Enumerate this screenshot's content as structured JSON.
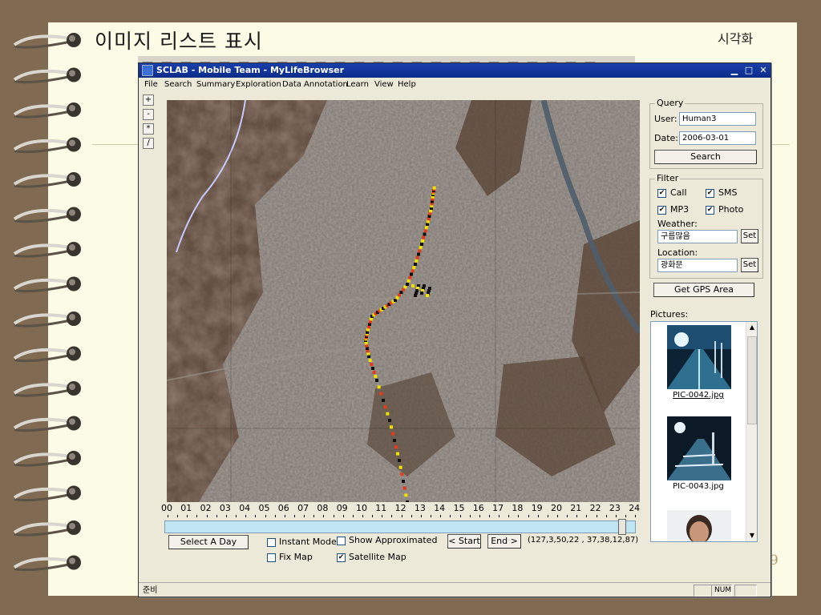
{
  "slide": {
    "title": "이미지 리스트 표시",
    "tag": "시각화",
    "page_number": "9"
  },
  "window": {
    "title": "SCLAB - Mobile Team - MyLifeBrowser",
    "minimize": "▁",
    "maximize": "□",
    "close": "✕"
  },
  "menu": [
    "File",
    "Search",
    "Summary",
    "Exploration",
    "Data Annotation",
    "Learn",
    "View",
    "Help"
  ],
  "tools": [
    "+",
    "-",
    "*",
    "/"
  ],
  "query": {
    "legend": "Query",
    "user_label": "User:",
    "user_value": "Human3",
    "date_label": "Date:",
    "date_value": "2006-03-01",
    "search_button": "Search"
  },
  "filter": {
    "legend": "Filter",
    "call": "Call",
    "sms": "SMS",
    "mp3": "MP3",
    "photo": "Photo",
    "call_checked": true,
    "sms_checked": true,
    "mp3_checked": true,
    "photo_checked": true,
    "weather_label": "Weather:",
    "weather_value": "구름많음",
    "location_label": "Location:",
    "location_value": "광화문",
    "set_button": "Set"
  },
  "gps_button": "Get GPS Area",
  "pictures": {
    "label": "Pictures:",
    "items": [
      "PIC-0042.jpg",
      "PIC-0043.jpg"
    ]
  },
  "timeline": {
    "hours": [
      "00",
      "01",
      "02",
      "03",
      "04",
      "05",
      "06",
      "07",
      "08",
      "09",
      "10",
      "11",
      "12",
      "13",
      "14",
      "15",
      "16",
      "17",
      "18",
      "19",
      "20",
      "21",
      "22",
      "23",
      "24"
    ],
    "slider_position": 0.98
  },
  "controls": {
    "select_day": "Select A Day",
    "instant_mode": "Instant Mode",
    "show_approx": "Show Approximated",
    "start": "< Start",
    "end": "End >",
    "coords": "(127,3,50,22 , 37,38,12,87)",
    "fix_map": "Fix Map",
    "satellite_map": "Satellite Map",
    "instant_checked": false,
    "approx_checked": false,
    "fix_checked": false,
    "satellite_checked": true
  },
  "status": {
    "text": "준비",
    "num": "NUM"
  },
  "colors": {
    "titlebar": "#0a2c8a",
    "track_primary": "#f2e200",
    "track_secondary": "#e63b1a",
    "track_points": "#111111"
  }
}
